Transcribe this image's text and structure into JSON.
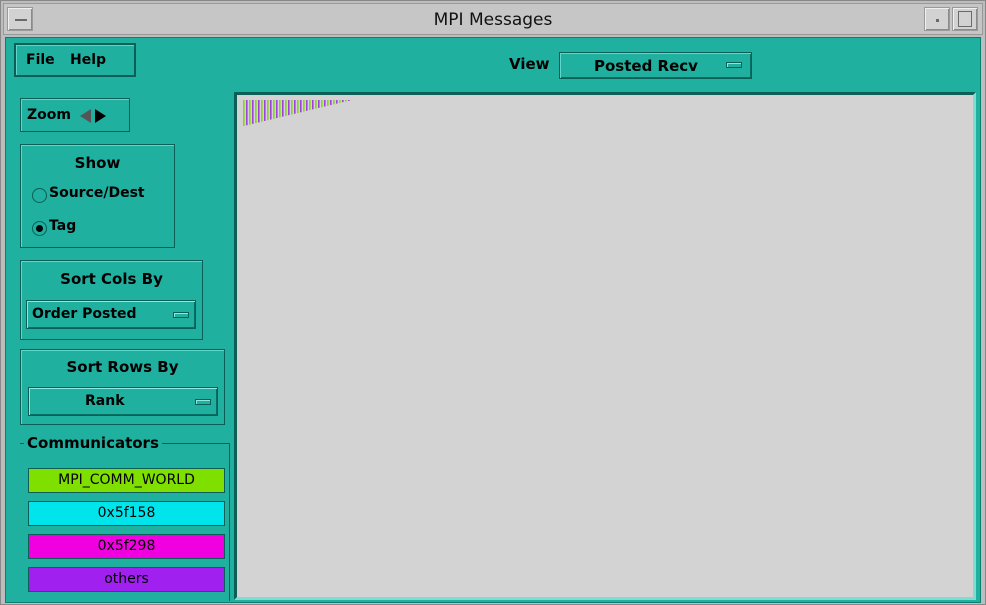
{
  "window": {
    "title": "MPI Messages"
  },
  "menu": {
    "file": "File",
    "help": "Help"
  },
  "view": {
    "label": "View",
    "selected": "Posted Recv"
  },
  "zoom": {
    "label": "Zoom"
  },
  "show": {
    "title": "Show",
    "options": [
      {
        "label": "Source/Dest",
        "selected": false
      },
      {
        "label": "Tag",
        "selected": true
      }
    ]
  },
  "sort_cols": {
    "title": "Sort Cols By",
    "selected": "Order Posted"
  },
  "sort_rows": {
    "title": "Sort Rows By",
    "selected": "Rank"
  },
  "communicators": {
    "title": "Communicators",
    "items": [
      {
        "label": "MPI_COMM_WORLD",
        "color": "#7fe000"
      },
      {
        "label": "0x5f158",
        "color": "#00e5ec"
      },
      {
        "label": "0x5f298",
        "color": "#f000e0"
      },
      {
        "label": "others",
        "color": "#a020f0"
      }
    ]
  },
  "colors": {
    "client_bg": "#1fb0a0",
    "canvas_bg": "#d3d3d3",
    "titlebar_bg": "#c6c6c6"
  }
}
